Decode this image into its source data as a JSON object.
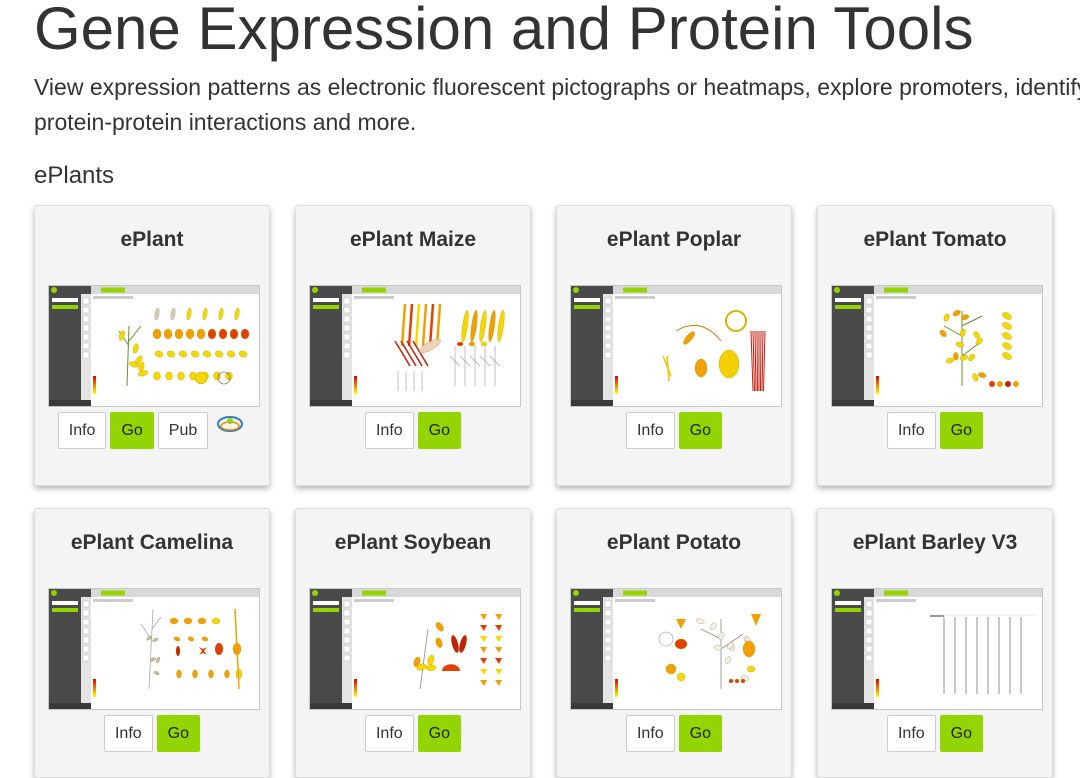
{
  "header": {
    "title": "Gene Expression and Protein Tools",
    "lead": "View expression patterns as electronic fluorescent pictographs or heatmaps, explore promoters, identify protein-protein interactions and more."
  },
  "section": {
    "title": "ePlants"
  },
  "buttons": {
    "info": "Info",
    "go": "Go",
    "pub": "Pub"
  },
  "colors": {
    "go_green": "#93d500",
    "card_bg": "#f4f4f4",
    "app_dark": "#4a4a4a"
  },
  "cards": [
    {
      "title": "ePlant",
      "has_pub": true,
      "plant": "arabidopsis"
    },
    {
      "title": "ePlant Maize",
      "has_pub": false,
      "plant": "maize"
    },
    {
      "title": "ePlant Poplar",
      "has_pub": false,
      "plant": "poplar"
    },
    {
      "title": "ePlant Tomato",
      "has_pub": false,
      "plant": "tomato"
    },
    {
      "title": "ePlant Camelina",
      "has_pub": false,
      "plant": "camelina"
    },
    {
      "title": "ePlant Soybean",
      "has_pub": false,
      "plant": "soybean"
    },
    {
      "title": "ePlant Potato",
      "has_pub": false,
      "plant": "potato"
    },
    {
      "title": "ePlant Barley V3",
      "has_pub": false,
      "plant": "barley"
    }
  ]
}
